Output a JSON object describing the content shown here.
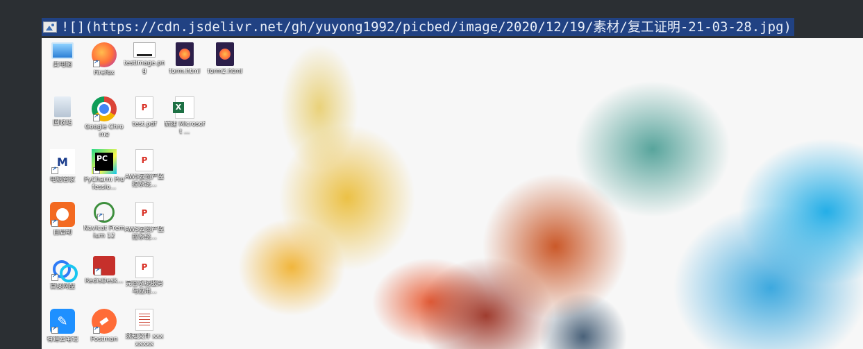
{
  "editor": {
    "selected_text": "![](https://cdn.jsdelivr.net/gh/yuyong1992/picbed/image/2020/12/19/素材/复工证明-21-03-28.jpg)",
    "icon": "image-file-icon"
  },
  "desktop": {
    "wallpaper": "abstract-ink-smoke",
    "icons": [
      {
        "label": "此电脑",
        "icon": "computer-icon",
        "glyph": "g-monitor",
        "col": 0,
        "row": 0,
        "shortcut": false
      },
      {
        "label": "Firefox",
        "icon": "firefox-icon",
        "glyph": "g-firefox",
        "col": 1,
        "row": 0,
        "shortcut": true
      },
      {
        "label": "testImage.png",
        "icon": "image-file-icon",
        "glyph": "g-file-dark",
        "col": 2,
        "row": 0,
        "shortcut": false
      },
      {
        "label": "form.html",
        "icon": "html-file-icon",
        "glyph": "g-ffdoc",
        "col": 3,
        "row": 0,
        "shortcut": false
      },
      {
        "label": "form2.html",
        "icon": "html-file-icon",
        "glyph": "g-ffdoc",
        "col": 4,
        "row": 0,
        "shortcut": false
      },
      {
        "label": "回收站",
        "icon": "recycle-bin-icon",
        "glyph": "g-recycle",
        "col": 0,
        "row": 1,
        "shortcut": false
      },
      {
        "label": "Google Chrome",
        "icon": "chrome-icon",
        "glyph": "g-chrome",
        "col": 1,
        "row": 1,
        "shortcut": true
      },
      {
        "label": "test.pdf",
        "icon": "pdf-file-icon",
        "glyph": "g-pdf",
        "col": 2,
        "row": 1,
        "shortcut": false
      },
      {
        "label": "新建 Microsoft ...",
        "icon": "excel-file-icon",
        "glyph": "g-excel",
        "col": 3,
        "row": 1,
        "shortcut": false
      },
      {
        "label": "电脑管家",
        "icon": "mi-app-icon",
        "glyph": "g-mi",
        "col": 0,
        "row": 2,
        "shortcut": true
      },
      {
        "label": "PyCharm Professio...",
        "icon": "pycharm-icon",
        "glyph": "g-pycharm",
        "col": 1,
        "row": 2,
        "shortcut": true
      },
      {
        "label": "AWS云资产监控系统...",
        "icon": "pdf-file-icon",
        "glyph": "g-pdf",
        "col": 2,
        "row": 2,
        "shortcut": false
      },
      {
        "label": "自启动",
        "icon": "autorun-app-icon",
        "glyph": "g-autorun",
        "col": 0,
        "row": 3,
        "shortcut": true
      },
      {
        "label": "Navicat Premium 12",
        "icon": "navicat-icon",
        "glyph": "g-navicat",
        "col": 1,
        "row": 3,
        "shortcut": true
      },
      {
        "label": "AWS云资产监控系统...",
        "icon": "pdf-file-icon",
        "glyph": "g-pdf",
        "col": 2,
        "row": 3,
        "shortcut": false
      },
      {
        "label": "百度网盘",
        "icon": "baidu-netdisk-icon",
        "glyph": "g-baidu",
        "col": 0,
        "row": 4,
        "shortcut": true
      },
      {
        "label": "RedisDesk...",
        "icon": "redis-desktop-icon",
        "glyph": "g-redis",
        "col": 1,
        "row": 4,
        "shortcut": true
      },
      {
        "label": "完善系统服务与应用...",
        "icon": "pdf-file-icon",
        "glyph": "g-pdf",
        "col": 2,
        "row": 4,
        "shortcut": false
      },
      {
        "label": "有道云笔记",
        "icon": "notes-app-icon",
        "glyph": "g-docs",
        "col": 0,
        "row": 5,
        "shortcut": true
      },
      {
        "label": "Postman",
        "icon": "postman-icon",
        "glyph": "g-postman",
        "col": 1,
        "row": 5,
        "shortcut": true
      },
      {
        "label": "须知文件 xxxxxxxx",
        "icon": "document-file-icon",
        "glyph": "g-doclines",
        "col": 2,
        "row": 5,
        "shortcut": false
      }
    ]
  }
}
